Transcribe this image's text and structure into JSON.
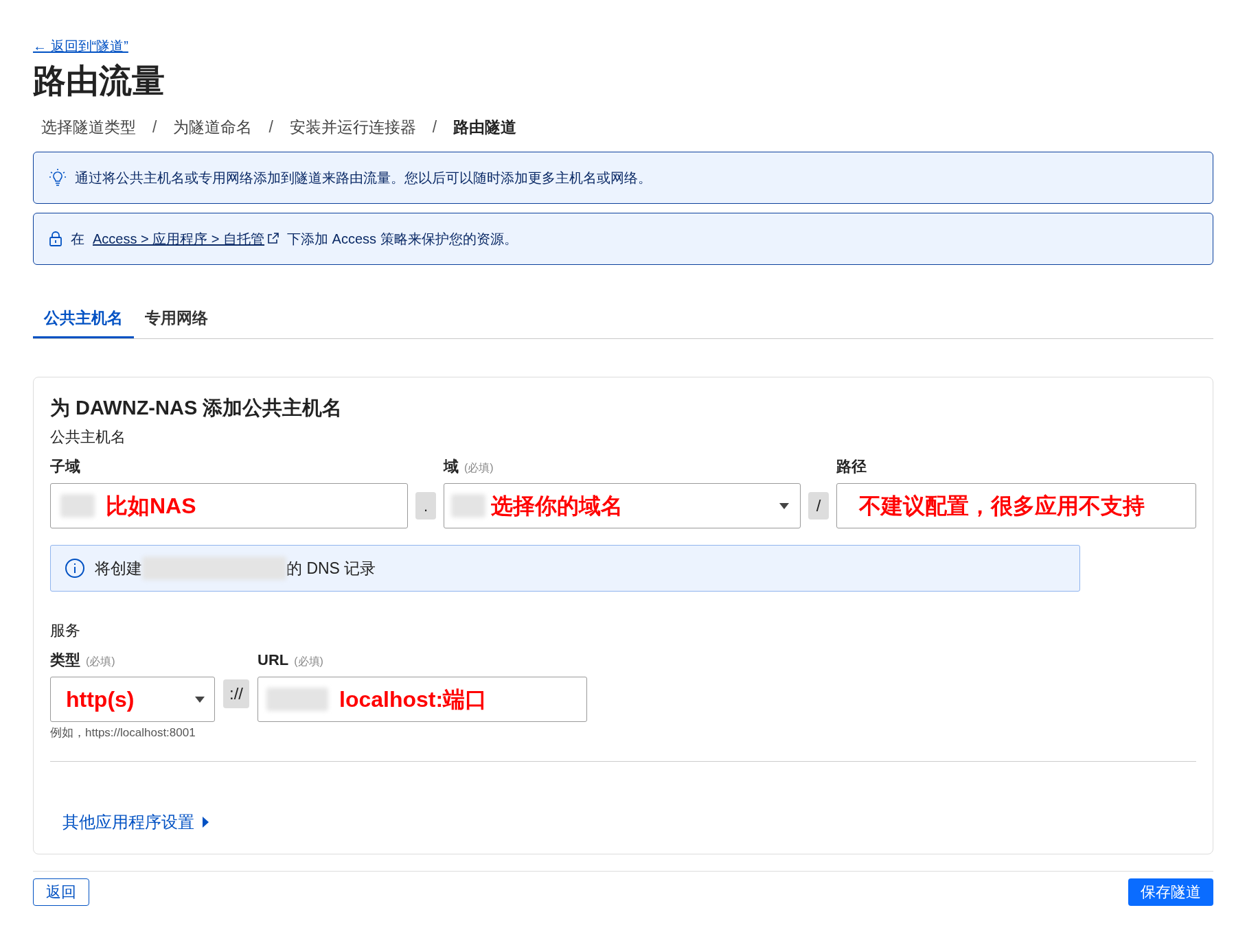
{
  "back_link": "← 返回到“隧道”",
  "title": "路由流量",
  "steps": [
    {
      "label": "选择隧道类型",
      "selected": false
    },
    {
      "label": "为隧道命名",
      "selected": false
    },
    {
      "label": "安装并运行连接器",
      "selected": false
    },
    {
      "label": "路由隧道",
      "selected": true
    }
  ],
  "step_separator": "/",
  "banners": [
    {
      "kind": "tip",
      "parts": [
        {
          "kind": "text",
          "text": "通过将公共主机名或专用网络添加到隧道来路由流量。您以后可以随时添加更多主机名或网络。"
        }
      ]
    },
    {
      "kind": "lock",
      "parts": [
        {
          "kind": "text",
          "text": "在"
        },
        {
          "kind": "link",
          "text": "Access > 应用程序 > 自托管"
        },
        {
          "kind": "text",
          "text": "下添加 Access 策略来保护您的资源。"
        }
      ]
    }
  ],
  "tabs": [
    {
      "label": "公共主机名",
      "selected": true
    },
    {
      "label": "专用网络",
      "selected": false
    }
  ],
  "card": {
    "title": "为 DAWNZ-NAS 添加公共主机名",
    "hostname_section": "公共主机名",
    "subdomain": {
      "label": "子域",
      "value": "比如NAS"
    },
    "dot": ".",
    "domain": {
      "label": "域",
      "required": "(必填)",
      "value": "选择你的域名"
    },
    "slash": "/",
    "path": {
      "label": "路径",
      "value": "不建议配置，很多应用不支持"
    },
    "dns_note": {
      "before": "将创建",
      "after": "的 DNS 记录"
    },
    "service_section": "服务",
    "type": {
      "label": "类型",
      "required": "(必填)",
      "value": "http(s)",
      "hint": "例如，https://localhost:8001"
    },
    "scheme_sep": "://",
    "url": {
      "label": "URL",
      "required": "(必填)",
      "value": "localhost:端口"
    },
    "more_settings": "其他应用程序设置"
  },
  "buttons": {
    "back": "返回",
    "save": "保存隧道"
  }
}
